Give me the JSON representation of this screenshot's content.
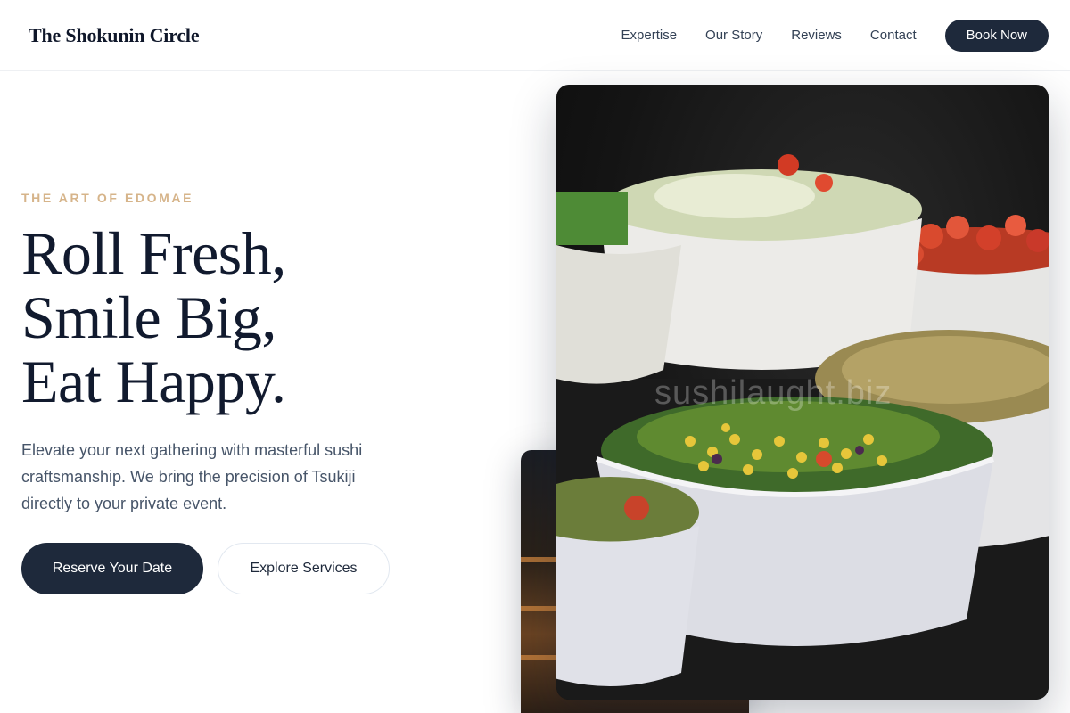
{
  "header": {
    "brand": "The Shokunin Circle",
    "nav": [
      "Expertise",
      "Our Story",
      "Reviews",
      "Contact"
    ],
    "book_label": "Book Now"
  },
  "hero": {
    "eyebrow": "THE ART OF EDOMAE",
    "headline": [
      "Roll Fresh,",
      "Smile Big,",
      "Eat Happy."
    ],
    "lead": "Elevate your next gathering with masterful sushi craftsmanship. We bring the precision of Tsukiji directly to your private event.",
    "primary_cta": "Reserve Your Date",
    "secondary_cta": "Explore Services"
  },
  "image": {
    "watermark": "sushilaught.biz",
    "subject": "bowls of fresh salads"
  },
  "colors": {
    "accent": "#d6b48a",
    "button": "#1e293b",
    "heading": "#111a2e",
    "body": "#475569"
  }
}
